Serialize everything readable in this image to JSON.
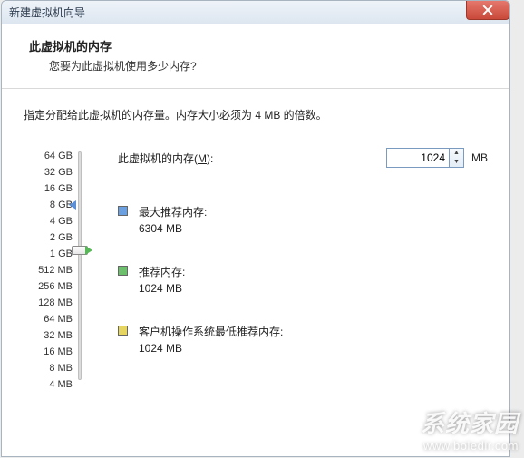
{
  "window": {
    "title": "新建虚拟机向导"
  },
  "header": {
    "title": "此虚拟机的内存",
    "subtitle": "您要为此虚拟机使用多少内存?"
  },
  "instruction": "指定分配给此虚拟机的内存量。内存大小必须为 4 MB 的倍数。",
  "input": {
    "label_prefix": "此虚拟机的内存(",
    "label_key": "M",
    "label_suffix": "):",
    "value": "1024",
    "unit": "MB"
  },
  "slider": {
    "ticks": [
      "64 GB",
      "32 GB",
      "16 GB",
      "8 GB",
      "4 GB",
      "2 GB",
      "1 GB",
      "512 MB",
      "256 MB",
      "128 MB",
      "64 MB",
      "32 MB",
      "16 MB",
      "8 MB",
      "4 MB"
    ]
  },
  "markers": {
    "max": {
      "color_tri": "#5b8fd6",
      "color_box": "#6aa0e0",
      "label": "最大推荐内存:",
      "value": "6304 MB"
    },
    "rec": {
      "color_tri": "#58b858",
      "color_box": "#6cc06c",
      "label": "推荐内存:",
      "value": "1024 MB"
    },
    "min": {
      "color_tri": "#d8c24a",
      "color_box": "#e6d55e",
      "label": "客户机操作系统最低推荐内存:",
      "value": "1024 MB"
    }
  },
  "watermark": {
    "line1": "系统家园",
    "line2": "www.boledir.com"
  }
}
